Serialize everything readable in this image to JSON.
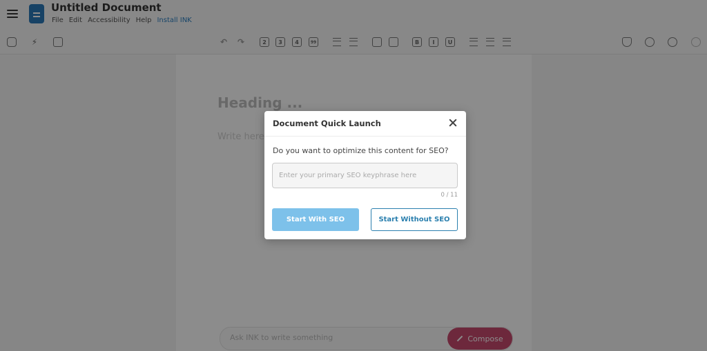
{
  "header": {
    "title": "Untitled Document",
    "menu": [
      "File",
      "Edit",
      "Accessibility",
      "Help",
      "Install INK"
    ]
  },
  "toolbar": {
    "heading_levels": [
      "2",
      "3",
      "4",
      "99"
    ],
    "format_buttons": [
      "B",
      "I",
      "U"
    ]
  },
  "editor": {
    "heading_placeholder": "Heading ...",
    "body_placeholder": "Write here..."
  },
  "prompt_bar": {
    "placeholder": "Ask INK to write something",
    "compose_label": "Compose"
  },
  "dialog": {
    "title": "Document Quick Launch",
    "question": "Do you want to optimize this content for SEO?",
    "input_placeholder": "Enter your primary SEO keyphrase here",
    "input_value": "",
    "counter": "0 / 11",
    "primary_button": "Start With SEO",
    "secondary_button": "Start Without SEO"
  },
  "colors": {
    "accent": "#2a7fae",
    "primary_button_bg": "#7dc1ea",
    "compose_bg": "#c64a6e",
    "logo": "#2a79b8"
  }
}
